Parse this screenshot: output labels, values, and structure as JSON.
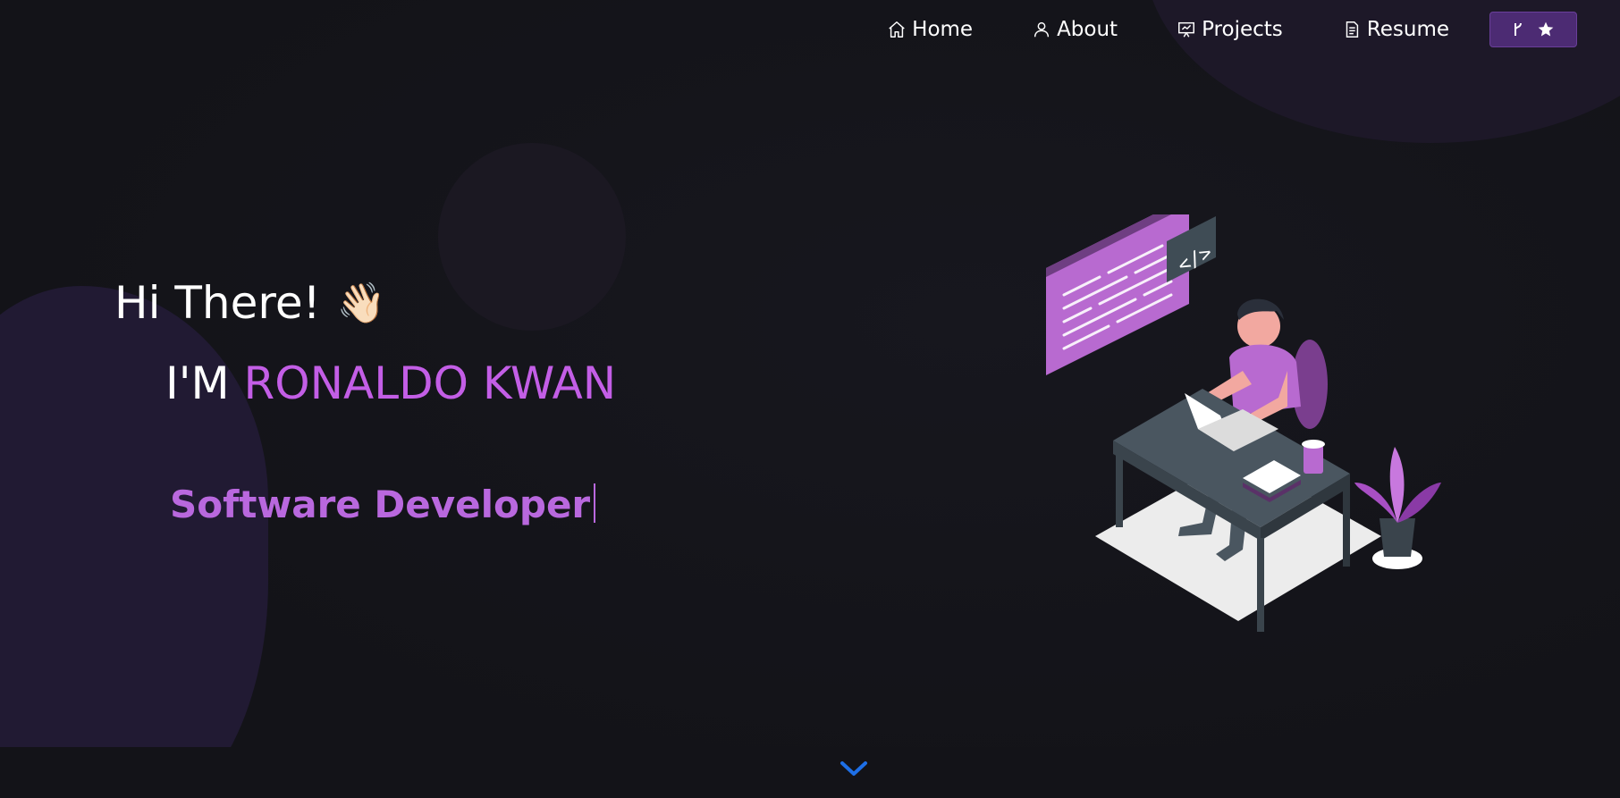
{
  "nav": {
    "items": [
      {
        "label": "Home",
        "icon": "home-icon"
      },
      {
        "label": "About",
        "icon": "user-icon"
      },
      {
        "label": "Projects",
        "icon": "presentation-icon"
      },
      {
        "label": "Resume",
        "icon": "document-icon"
      }
    ],
    "github_button": {
      "icons": [
        "fork-icon",
        "star-icon"
      ]
    }
  },
  "hero": {
    "greeting": "Hi There!",
    "wave_emoji": "👋🏻",
    "name_prefix": "I'M",
    "name": "RONALDO KWAN",
    "typed_text": "Software Developer",
    "illustration_code_tag": "</>"
  },
  "colors": {
    "background": "#16161c",
    "accent_purple": "#c35ee6",
    "button_purple": "#4c2b73",
    "chevron_blue": "#1e6fe6"
  },
  "scroll_indicator": {
    "icon": "chevron-down-icon"
  }
}
